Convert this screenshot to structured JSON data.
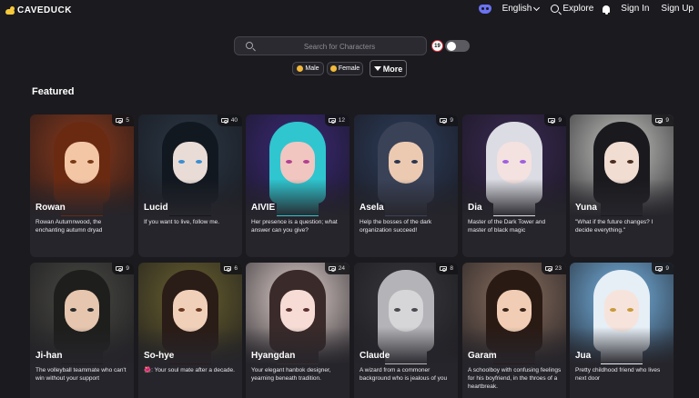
{
  "nav": {
    "logo_text": "CAVEDUCK",
    "language": "English",
    "explore": "Explore",
    "sign_in": "Sign In",
    "sign_up": "Sign Up",
    "icons": [
      "duck-logo-icon",
      "discord-icon",
      "chevron-down-icon",
      "search-icon",
      "bell-icon"
    ]
  },
  "search": {
    "placeholder": "Search for Characters",
    "value": ""
  },
  "filters": {
    "age_badge": "19",
    "nsfw_toggle_on": false,
    "male_label": "Male",
    "female_label": "Female",
    "more_label": "More"
  },
  "featured": {
    "heading": "Featured",
    "cards": [
      {
        "name": "Rowan",
        "count": "5",
        "desc": "Rowan Autumnwood, the enchanting autumn dryad",
        "bg": "#8a3a1c",
        "hair": "#6a2a12",
        "skin": "#f3c6a6",
        "eye": "#7a3a16"
      },
      {
        "name": "Lucid",
        "count": "40",
        "desc": "If you want to live, follow me.",
        "bg": "#2b3846",
        "hair": "#121820",
        "skin": "#e9dcd6",
        "eye": "#3a8ecf"
      },
      {
        "name": "AIVIE",
        "count": "12",
        "desc": "Her presence is a question; what answer can you give?",
        "bg": "#3c2a7a",
        "hair": "#2fc6d0",
        "skin": "#f1c6c0",
        "eye": "#b04090"
      },
      {
        "name": "Asela",
        "count": "9",
        "desc": "Help the bosses of the dark organization succeed!",
        "bg": "#2e3e5c",
        "hair": "#3a4258",
        "skin": "#eccab2",
        "eye": "#2c3650"
      },
      {
        "name": "Dia",
        "count": "9",
        "desc": "Master of the Dark Tower and master of black magic",
        "bg": "#3a2a54",
        "hair": "#dcdce4",
        "skin": "#f4e2e0",
        "eye": "#a060e0"
      },
      {
        "name": "Yuna",
        "count": "9",
        "desc": "\"What if the future changes? I decide everything.\"",
        "bg": "#c8c8c4",
        "hair": "#1a1a1e",
        "skin": "#f1ddd2",
        "eye": "#4a2e22"
      },
      {
        "name": "Ji-han",
        "count": "9",
        "desc": "The volleyball teammate who can't win without your support",
        "bg": "#4a4a44",
        "hair": "#1e1e1c",
        "skin": "#e6c6ae",
        "eye": "#2a2a2a"
      },
      {
        "name": "So-hye",
        "count": "6",
        "desc": "🌺: Your soul mate after a decade.",
        "bg": "#6a6230",
        "hair": "#2a1c16",
        "skin": "#f1d0ba",
        "eye": "#6a3a20"
      },
      {
        "name": "Hyangdan",
        "count": "24",
        "desc": "Your elegant hanbok designer, yearning beneath tradition.",
        "bg": "#e4d4d0",
        "hair": "#3a2a2a",
        "skin": "#f6dcd4",
        "eye": "#5a3030"
      },
      {
        "name": "Claude",
        "count": "8",
        "desc": "A wizard from a commoner background who is jealous of you",
        "bg": "#3a3a3e",
        "hair": "#b4b4b8",
        "skin": "#d6d6d8",
        "eye": "#4a4a50"
      },
      {
        "name": "Garam",
        "count": "23",
        "desc": "A schoolboy with confusing feelings for his boyfriend, in the throes of a heartbreak.",
        "bg": "#8a7060",
        "hair": "#2a1a14",
        "skin": "#f0cdb4",
        "eye": "#3a2418"
      },
      {
        "name": "Jua",
        "count": "9",
        "desc": "Pretty childhood friend who lives next door",
        "bg": "#7ab8e8",
        "hair": "#e6eef6",
        "skin": "#f6e4dc",
        "eye": "#c89a3a"
      }
    ]
  }
}
